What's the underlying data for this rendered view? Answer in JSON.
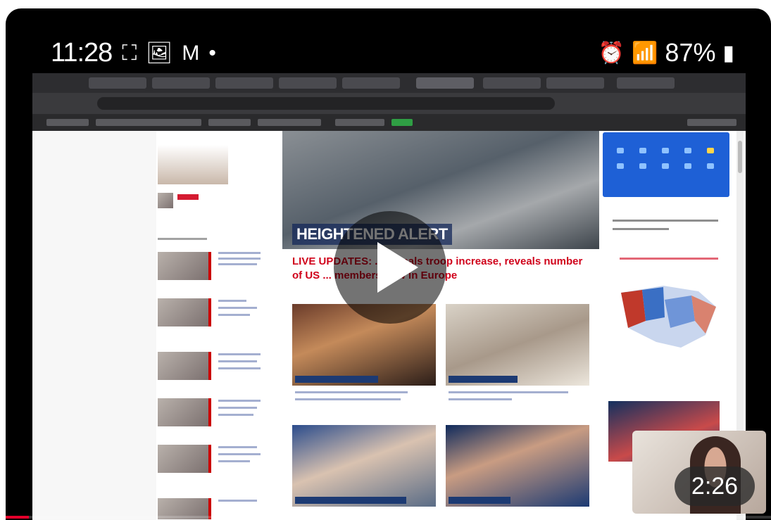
{
  "status_bar": {
    "time": "11:28",
    "battery": "87%"
  },
  "browser": {
    "url": ""
  },
  "news": {
    "hero_label": "HEIGHTENED ALERT",
    "headline": "LIVE UPDATES: ... signals troop increase, reveals number of US ... members now in Europe"
  },
  "video": {
    "duration": "2:26",
    "progress_fraction": 0.03
  }
}
